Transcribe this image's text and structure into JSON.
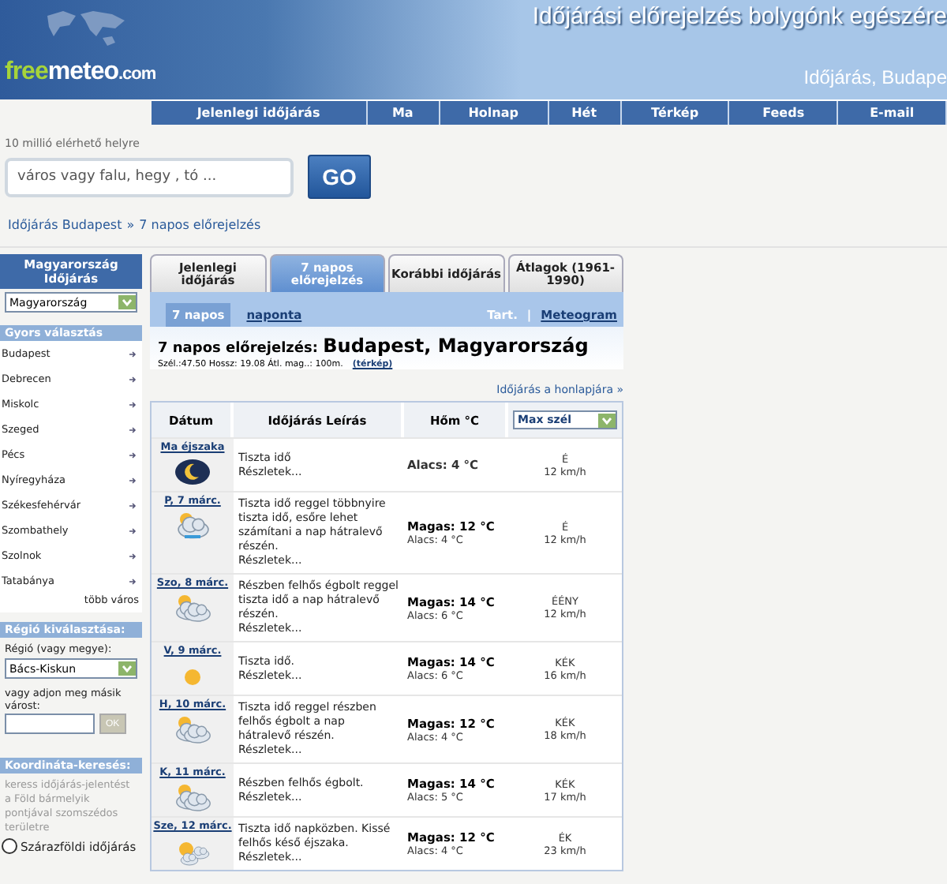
{
  "header": {
    "logo": [
      "free",
      "meteo",
      ".com"
    ],
    "title": "Időjárási előrejelzés bolygónk egészére",
    "subtitle": "Időjárás, Budape"
  },
  "nav": [
    "Jelenlegi időjárás",
    "Ma",
    "Holnap",
    "Hét",
    "Térkép",
    "Feeds",
    "E-mail"
  ],
  "search": {
    "hint": "10 millió elérhető helyre",
    "placeholder": "város vagy falu, hegy , tó ...",
    "button": "GO"
  },
  "breadcrumb": [
    "Időjárás Budapest",
    "»",
    "7 napos előrejelzés"
  ],
  "sidebar": {
    "country": {
      "title": "Magyarország Időjárás",
      "select": "Magyarország"
    },
    "quick": {
      "title": "Gyors választás",
      "cities": [
        "Budapest",
        "Debrecen",
        "Miskolc",
        "Szeged",
        "Pécs",
        "Nyíregyháza",
        "Székesfehérvár",
        "Szombathely",
        "Szolnok",
        "Tatabánya"
      ],
      "more": "több város"
    },
    "region": {
      "title": "Régió kiválasztása:",
      "label": "Régió (vagy megye):",
      "select": "Bács-Kiskun",
      "other_label": "vagy adjon meg másik várost:",
      "ok": "OK"
    },
    "coords": {
      "title": "Koordináta-keresés:",
      "text": "keress időjárás-jelentést a Föld bármelyik pontjával szomszédos területre",
      "radio": {
        "label": "Szárazföldi időjárás",
        "selected": false
      }
    }
  },
  "tabs": [
    {
      "label": "Jelenlegi időjárás",
      "selected": false
    },
    {
      "label": "7 napos előrejelzés",
      "selected": true
    },
    {
      "label": "Korábbi időjárás",
      "selected": false
    },
    {
      "label": "Átlagok (1961-1990)",
      "selected": false
    }
  ],
  "subtabs": [
    {
      "label": "7 napos",
      "selected": true
    },
    {
      "label": "naponta",
      "selected": false
    }
  ],
  "sublinks": [
    "Tart.",
    "|",
    "Meteogram"
  ],
  "heading": {
    "prefix": "7 napos előrejelzés:",
    "place": "Budapest, Magyarország",
    "coords": "Szél.:47.50 Hossz: 19.08 Átl. mag..: 100m.",
    "map_link": "(térkép)",
    "homepage_link": "Időjárás a honlapjára »"
  },
  "table": {
    "columns": [
      "Dátum",
      "Időjárás Leírás",
      "Hőm °C"
    ],
    "wind_select": "Max szél",
    "rows": [
      {
        "date": "Ma éjszaka",
        "kind": "moon",
        "description": "Tiszta idő",
        "details": "Részletek...",
        "low": "Alacs: 4  °C",
        "wind_dir": "É",
        "wind_speed": "12 km/h"
      },
      {
        "date": "P, 7 márc.",
        "kind": "rain",
        "description": "Tiszta idő reggel többnyire tiszta idő, esőre lehet számítani a nap hátralevő részén.",
        "details": "Részletek...",
        "high": "Magas: 12  °C",
        "low": "Alacs: 4  °C",
        "wind_dir": "É",
        "wind_speed": "12 km/h"
      },
      {
        "date": "Szo, 8 márc.",
        "kind": "cloudy",
        "description": "Részben felhős égbolt reggel tiszta idő a nap hátralevő részén.",
        "details": "Részletek...",
        "high": "Magas: 14  °C",
        "low": "Alacs: 6  °C",
        "wind_dir": "ÉÉNY",
        "wind_speed": "12 km/h"
      },
      {
        "date": "V, 9 márc.",
        "kind": "sun",
        "description": "Tiszta idő.",
        "details": "Részletek...",
        "high": "Magas: 14  °C",
        "low": "Alacs: 6  °C",
        "wind_dir": "KÉK",
        "wind_speed": "16 km/h"
      },
      {
        "date": "H, 10 márc.",
        "kind": "cloudy",
        "description": "Tiszta idő reggel részben felhős égbolt a nap hátralevő részén.",
        "details": "Részletek...",
        "high": "Magas: 12  °C",
        "low": "Alacs: 4  °C",
        "wind_dir": "KÉK",
        "wind_speed": "18 km/h"
      },
      {
        "date": "K, 11 márc.",
        "kind": "cloudy",
        "description": "Részben felhős égbolt.",
        "details": "Részletek...",
        "high": "Magas: 14  °C",
        "low": "Alacs: 5  °C",
        "wind_dir": "KÉK",
        "wind_speed": "17 km/h"
      },
      {
        "date": "Sze, 12 márc.",
        "kind": "suncloud",
        "description": "Tiszta idő napközben. Kissé felhős késő éjszaka.",
        "details": "Részletek...",
        "high": "Magas: 12  °C",
        "low": "Alacs: 4  °C",
        "wind_dir": "ÉK",
        "wind_speed": "23 km/h"
      }
    ]
  }
}
